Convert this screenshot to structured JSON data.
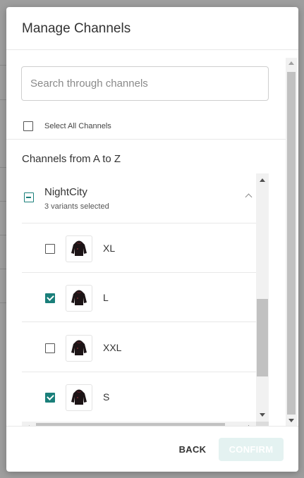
{
  "dialog": {
    "title": "Manage Channels"
  },
  "search": {
    "placeholder": "Search through channels",
    "value": ""
  },
  "select_all": {
    "label": "Select All Channels",
    "checked": false
  },
  "section_heading": "Channels from A to Z",
  "channel": {
    "name": "NightCity",
    "subtitle": "3 variants selected",
    "expanded": true
  },
  "variants": [
    {
      "label": "XL",
      "checked": false
    },
    {
      "label": "L",
      "checked": true
    },
    {
      "label": "XXL",
      "checked": false
    },
    {
      "label": "S",
      "checked": true
    }
  ],
  "footer": {
    "back_label": "BACK",
    "confirm_label": "CONFIRM",
    "confirm_disabled": true
  },
  "colors": {
    "accent": "#1a7f7a",
    "confirm_disabled_bg": "#e4f2f1",
    "overlay": "#9e9e9e"
  },
  "icons": {
    "thumbnail": "hoodie-icon",
    "collapse": "chevron-up-icon",
    "indeterminate": "indeterminate-checkbox-icon"
  }
}
